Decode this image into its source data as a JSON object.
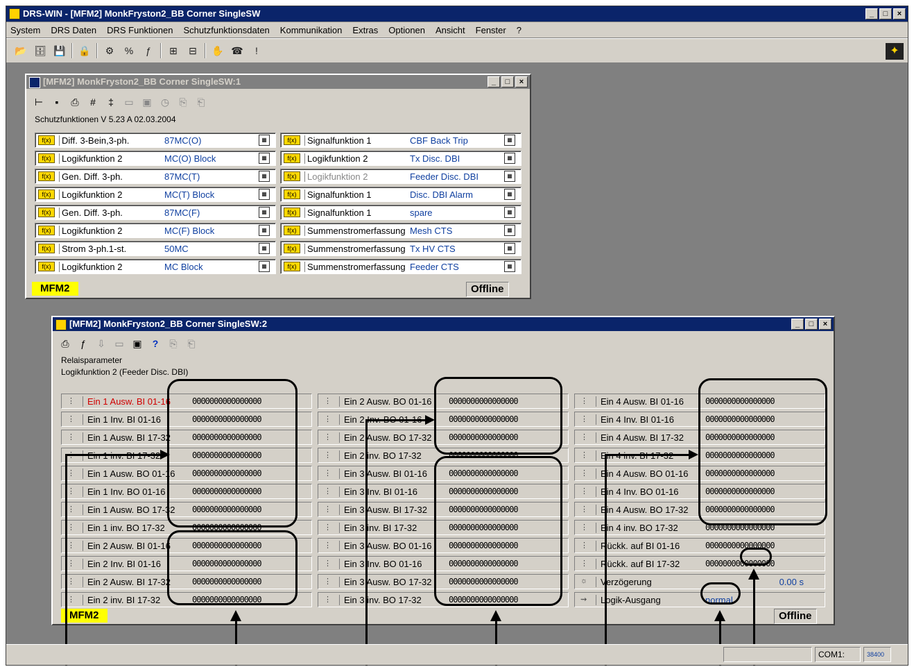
{
  "app": {
    "title": "DRS-WIN - [MFM2] MonkFryston2_BB Corner SingleSW",
    "menu": [
      "System",
      "DRS Daten",
      "DRS Funktionen",
      "Schutzfunktionsdaten",
      "Kommunikation",
      "Extras",
      "Optionen",
      "Ansicht",
      "Fenster",
      "?"
    ],
    "status_port": "COM1:",
    "status_baud": "38400"
  },
  "win1": {
    "title": "[MFM2] MonkFryston2_BB Corner SingleSW:1",
    "header": "Schutzfunktionen   V 5.23 A   02.03.2004",
    "left": [
      {
        "name": "Diff. 3-Bein,3-ph.",
        "value": "87MC(O)"
      },
      {
        "name": "Logikfunktion 2",
        "value": "MC(O) Block"
      },
      {
        "name": "Gen. Diff. 3-ph.",
        "value": "87MC(T)"
      },
      {
        "name": "Logikfunktion 2",
        "value": "MC(T) Block"
      },
      {
        "name": "Gen. Diff. 3-ph.",
        "value": "87MC(F)"
      },
      {
        "name": "Logikfunktion 2",
        "value": "MC(F) Block"
      },
      {
        "name": "Strom 3-ph.1-st.",
        "value": "50MC"
      },
      {
        "name": "Logikfunktion 2",
        "value": "MC Block"
      }
    ],
    "right": [
      {
        "name": "Signalfunktion 1",
        "value": "CBF Back Trip"
      },
      {
        "name": "Logikfunktion 2",
        "value": "Tx Disc. DBI"
      },
      {
        "name": "Logikfunktion 2",
        "value": "Feeder Disc. DBI"
      },
      {
        "name": "Signalfunktion 1",
        "value": "Disc. DBI Alarm"
      },
      {
        "name": "Signalfunktion 1",
        "value": "spare"
      },
      {
        "name": "Summenstromerfassung",
        "value": "Mesh CTS"
      },
      {
        "name": "Summenstromerfassung",
        "value": "Tx HV CTS"
      },
      {
        "name": "Summenstromerfassung",
        "value": "Feeder CTS"
      }
    ],
    "status_device": "MFM2",
    "status_mode": "Offline"
  },
  "win2": {
    "title": "[MFM2] MonkFryston2_BB Corner SingleSW:2",
    "header1": "Relaisparameter",
    "header2": "Logikfunktion 2 (Feeder Disc. DBI)",
    "col1": [
      {
        "name": "Ein 1 Ausw. BI 01-16",
        "bits": "0000000000000000"
      },
      {
        "name": "Ein 1 Inv.  BI 01-16",
        "bits": "0000000000000000"
      },
      {
        "name": "Ein 1 Ausw. BI 17-32",
        "bits": "0000000000000000"
      },
      {
        "name": "Ein 1 inv.  BI 17-32",
        "bits": "0000000000000000"
      },
      {
        "name": "Ein 1 Ausw. BO 01-16",
        "bits": "0000000000000000"
      },
      {
        "name": "Ein 1 Inv.  BO 01-16",
        "bits": "0000000000000000"
      },
      {
        "name": "Ein 1 Ausw. BO 17-32",
        "bits": "0000000000000000"
      },
      {
        "name": "Ein 1 inv.  BO 17-32",
        "bits": "0000000000000000"
      },
      {
        "name": "Ein 2 Ausw. BI 01-16",
        "bits": "0000000000000000"
      },
      {
        "name": "Ein 2 Inv.  BI 01-16",
        "bits": "0000000000000000"
      },
      {
        "name": "Ein 2 Ausw. BI 17-32",
        "bits": "0000000000000000"
      },
      {
        "name": "Ein 2 inv.  BI 17-32",
        "bits": "0000000000000000"
      }
    ],
    "col2": [
      {
        "name": "Ein 2 Ausw. BO 01-16",
        "bits": "0000000000000000"
      },
      {
        "name": "Ein 2 Inv.  BO 01-16",
        "bits": "0000000000000000"
      },
      {
        "name": "Ein 2 Ausw. BO 17-32",
        "bits": "0000000000000000"
      },
      {
        "name": "Ein 2 inv.  BO 17-32",
        "bits": "0000000000000000"
      },
      {
        "name": "Ein 3 Ausw. BI 01-16",
        "bits": "0000000000000000"
      },
      {
        "name": "Ein 3 Inv.  BI 01-16",
        "bits": "0000000000000000"
      },
      {
        "name": "Ein 3 Ausw. BI 17-32",
        "bits": "0000000000000000"
      },
      {
        "name": "Ein 3 inv.  BI 17-32",
        "bits": "0000000000000000"
      },
      {
        "name": "Ein 3 Ausw. BO 01-16",
        "bits": "0000000000000000"
      },
      {
        "name": "Ein 3 Inv.  BO 01-16",
        "bits": "0000000000000000"
      },
      {
        "name": "Ein 3 Ausw. BO 17-32",
        "bits": "0000000000000000"
      },
      {
        "name": "Ein 3 inv.  BO 17-32",
        "bits": "0000000000000000"
      }
    ],
    "col3": [
      {
        "name": "Ein 4 Ausw. BI 01-16",
        "bits": "0000000000000000"
      },
      {
        "name": "Ein 4 Inv.  BI 01-16",
        "bits": "0000000000000000"
      },
      {
        "name": "Ein 4 Ausw. BI 17-32",
        "bits": "0000000000000000"
      },
      {
        "name": "Ein 4 inv.  BI 17-32",
        "bits": "0000000000000000"
      },
      {
        "name": "Ein 4 Ausw. BO 01-16",
        "bits": "0000000000000000"
      },
      {
        "name": "Ein 4 Inv.  BO 01-16",
        "bits": "0000000000000000"
      },
      {
        "name": "Ein 4 Ausw. BO 17-32",
        "bits": "0000000000000000"
      },
      {
        "name": "Ein 4 inv.  BO 17-32",
        "bits": "0000000000000000"
      },
      {
        "name": "Rückk. auf BI 01-16",
        "bits": "0000000000000000"
      },
      {
        "name": "Rückk. auf BI 17-32",
        "bits": "0000000000000000"
      },
      {
        "name": "Verzögerung",
        "value": "0.00  s"
      },
      {
        "name": "Logik-Ausgang",
        "value": "normal"
      }
    ],
    "status_device": "MFM2",
    "status_mode": "Offline"
  }
}
